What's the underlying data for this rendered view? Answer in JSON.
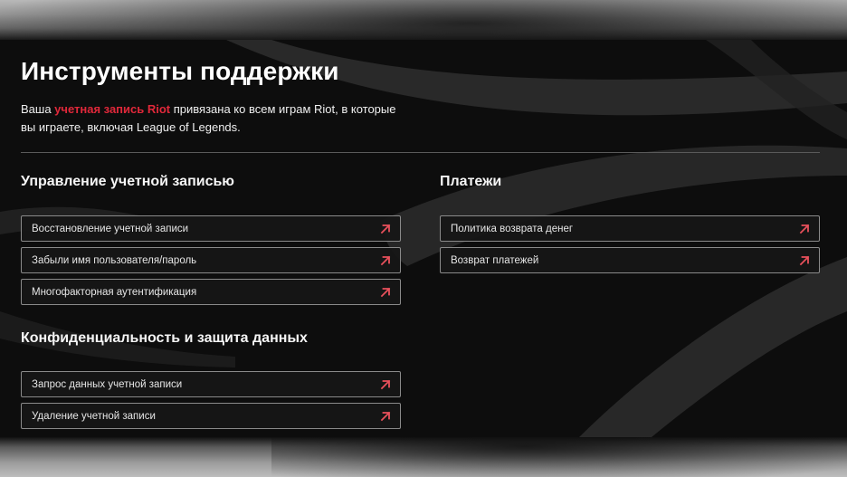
{
  "page": {
    "title": "Инструменты поддержки",
    "intro_before": "Ваша ",
    "intro_link": "учетная запись Riot",
    "intro_after": " привязана ко всем играм Riot, в которые вы играете, включая League of Legends."
  },
  "sections": {
    "account": {
      "title": "Управление учетной записью",
      "items": [
        {
          "label": "Восстановление учетной записи",
          "icon": "external-link-arrow-icon"
        },
        {
          "label": "Забыли имя пользователя/пароль",
          "icon": "external-link-arrow-icon"
        },
        {
          "label": "Многофакторная аутентификация",
          "icon": "external-link-arrow-icon"
        }
      ]
    },
    "privacy": {
      "title": "Конфиденциальность и защита данных",
      "items": [
        {
          "label": "Запрос данных учетной записи",
          "icon": "external-link-arrow-icon"
        },
        {
          "label": "Удаление учетной записи",
          "icon": "external-link-arrow-icon"
        }
      ]
    },
    "payments": {
      "title": "Платежи",
      "items": [
        {
          "label": "Политика возврата денег",
          "icon": "external-link-arrow-icon"
        },
        {
          "label": "Возврат платежей",
          "icon": "external-link-arrow-icon"
        }
      ]
    }
  },
  "colors": {
    "accent_red": "#e0283a",
    "arrow_red": "#e8505b",
    "background": "#0d0d0d",
    "text_white": "#ffffff",
    "border_gray": "#8a8a8a"
  }
}
